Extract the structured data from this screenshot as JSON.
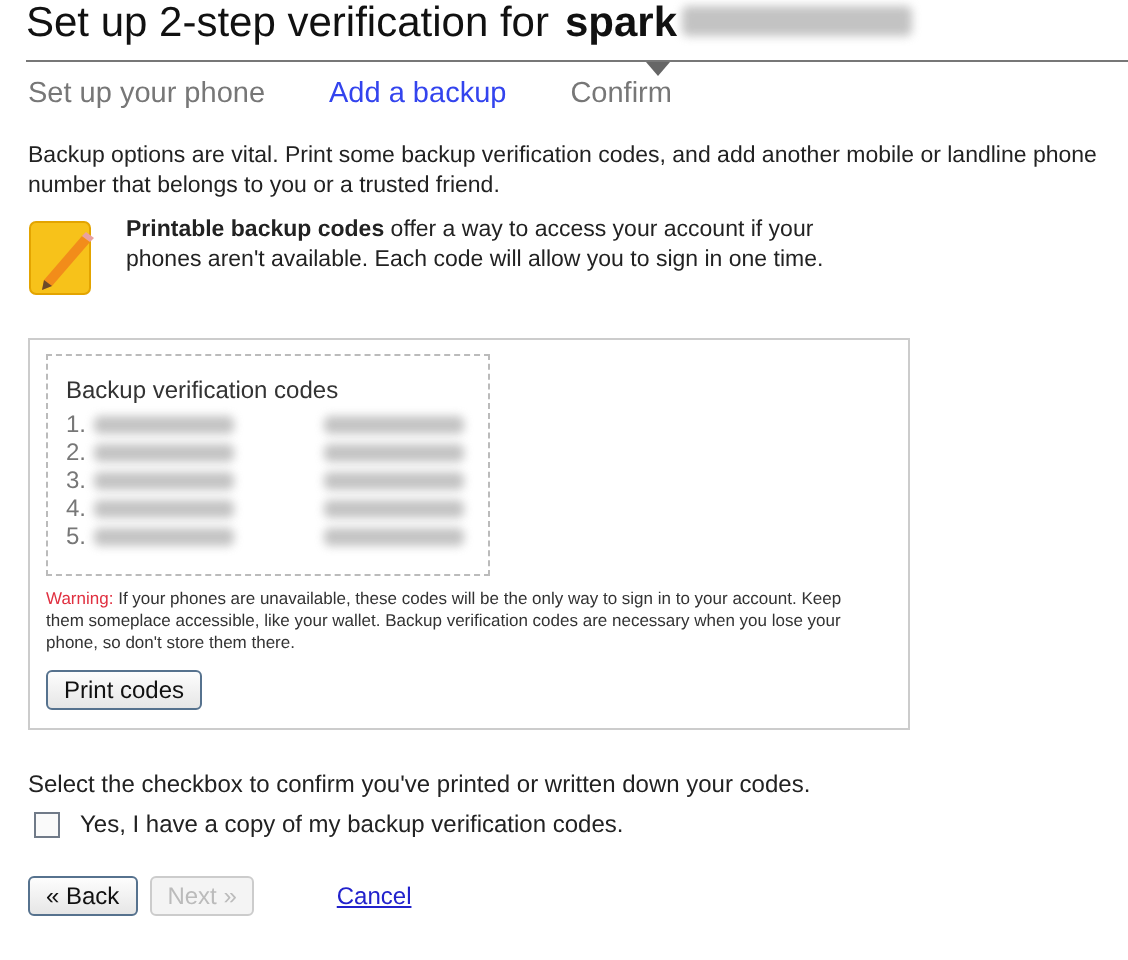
{
  "title": {
    "text": "Set up 2-step verification for",
    "account": "spark"
  },
  "steps": [
    {
      "label": "Set up your phone",
      "selected": false
    },
    {
      "label": "Add a backup",
      "selected": true
    },
    {
      "label": "Confirm",
      "selected": false
    }
  ],
  "intro": "Backup options are vital. Print some backup verification codes, and add another mobile or landline phone number that belongs to you or a trusted friend.",
  "tip": "**Printable backup codes** offer a way to access your account if your phones aren't available. Each code will allow you to sign in one time.",
  "codes_panel": {
    "heading": "Backup verification codes",
    "numbers": [
      "1.",
      "2.",
      "3.",
      "4.",
      "5."
    ],
    "warning_label": "Warning:",
    "warning": "If your phones are unavailable, these codes will be the only way to sign in to your account. Keep them someplace accessible, like your wallet. Backup verification codes are necessary when you lose your phone, so don't store them there.",
    "print_button": "Print codes"
  },
  "confirm_prompt": "Select the checkbox to confirm you've printed or written down your codes.",
  "confirm_checkbox": {
    "label": "Yes, I have a copy of my backup verification codes.",
    "checked": false
  },
  "buttons": [
    {
      "label": "« Back",
      "kind": "button",
      "disabled": false
    },
    {
      "label": "Next »",
      "kind": "button",
      "disabled": true
    },
    {
      "label": "Cancel",
      "kind": "link",
      "disabled": false
    }
  ]
}
